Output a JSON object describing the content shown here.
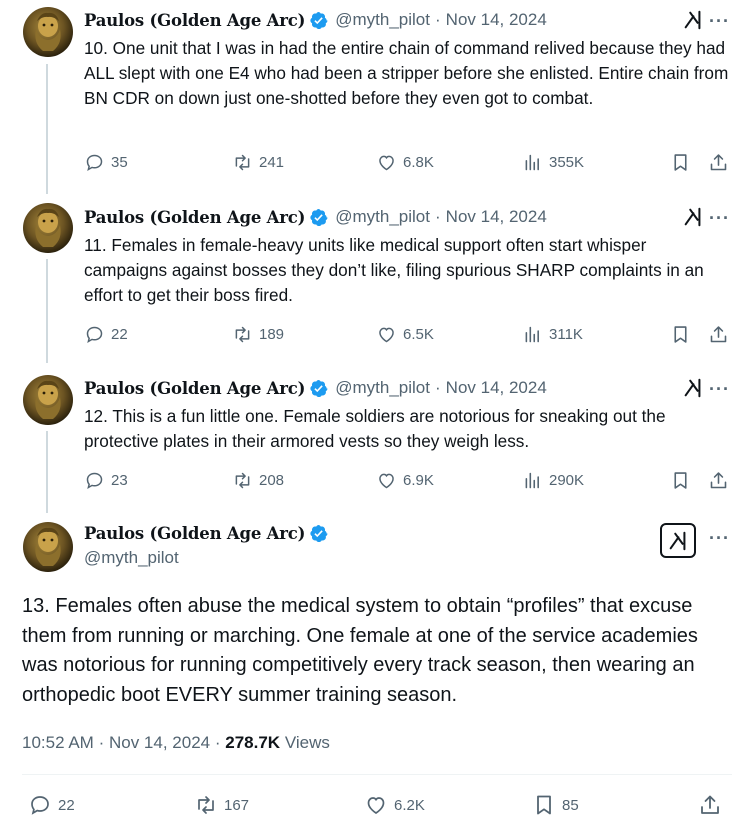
{
  "author": {
    "name": "Paulos (Golden Age Arc)",
    "handle": "@myth_pilot",
    "verified": true
  },
  "colors": {
    "verified_blue": "#1d9bf0",
    "secondary_text": "#536471",
    "primary_text": "#0f1419",
    "thread_line": "#cfd9de"
  },
  "tweets": [
    {
      "handle": "@myth_pilot",
      "date": "Nov 14, 2024",
      "text": "10. One unit that I was in had the entire chain of command relived because they had ALL slept with one E4 who had been a stripper before she enlisted. Entire chain from BN CDR on down just one-shotted before they even got to combat.",
      "replies": "35",
      "reposts": "241",
      "likes": "6.8K",
      "views": "355K"
    },
    {
      "handle": "@myth_pilot",
      "date": "Nov 14, 2024",
      "text": "11. Females in female-heavy units like medical support often start whisper campaigns against bosses they don’t like, filing spurious SHARP complaints in an effort to get their boss fired.",
      "replies": "22",
      "reposts": "189",
      "likes": "6.5K",
      "views": "311K"
    },
    {
      "handle": "@myth_pilot",
      "date": "Nov 14, 2024",
      "text": "12. This is a fun little one. Female soldiers are notorious for sneaking out the protective plates in their armored vests so they weigh less.",
      "replies": "23",
      "reposts": "208",
      "likes": "6.9K",
      "views": "290K"
    }
  ],
  "main_tweet": {
    "handle": "@myth_pilot",
    "text": "13. Females often abuse the medical system to obtain “profiles” that excuse them from running or marching. One female at one of the service academies was notorious for running competitively every track season, then wearing an orthopedic boot EVERY summer training season.",
    "time": "10:52 AM",
    "date": "Nov 14, 2024",
    "views_count": "278.7K",
    "views_label": "Views",
    "replies": "22",
    "reposts": "167",
    "likes": "6.2K",
    "bookmarks": "85"
  },
  "separator": "·",
  "more_label": "···"
}
